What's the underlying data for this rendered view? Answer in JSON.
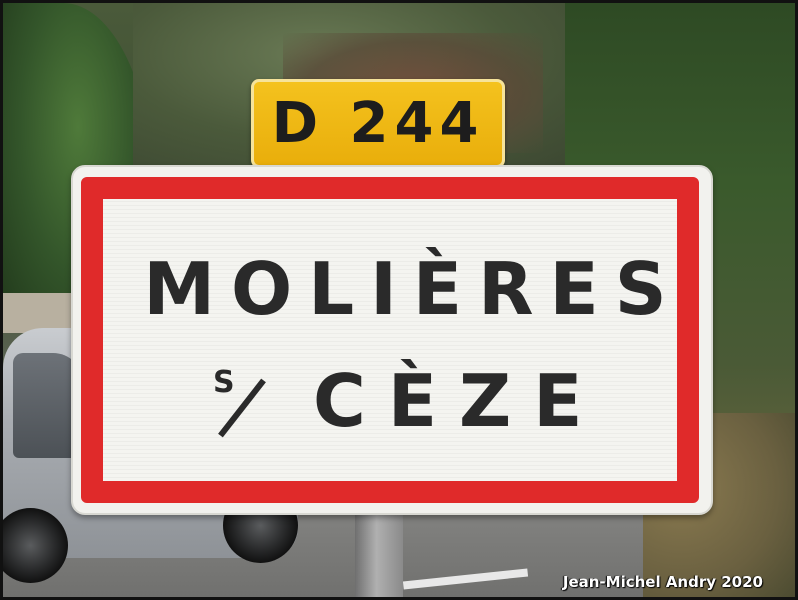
{
  "route_plate": {
    "text": "D 244",
    "color": "#f4c21e"
  },
  "town_sign": {
    "line1": "MOLIÈRES",
    "abbr_letter": "S",
    "line2": "CÈZE",
    "border_color": "#e02a2a"
  },
  "credit": {
    "text": "Jean-Michel Andry 2020"
  }
}
